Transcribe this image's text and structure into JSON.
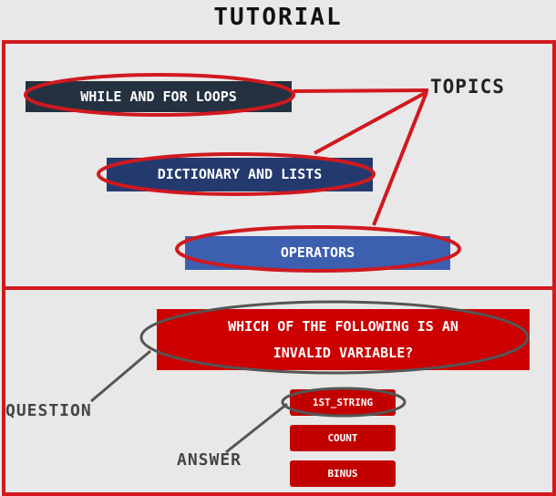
{
  "header": {
    "title": "TUTORIAL"
  },
  "topics": {
    "label": "TOPICS",
    "items": [
      {
        "label": "WHILE AND FOR LOOPS"
      },
      {
        "label": "DICTIONARY AND LISTS"
      },
      {
        "label": "OPERATORS"
      }
    ]
  },
  "question": {
    "label": "QUESTION",
    "line1": "WHICH OF THE FOLLOWING IS AN",
    "line2": "INVALID VARIABLE?"
  },
  "answers": {
    "label": "ANSWER",
    "options": [
      {
        "label": "1ST_STRING"
      },
      {
        "label": "COUNT"
      },
      {
        "label": "BINUS"
      }
    ]
  },
  "colors": {
    "accent_red": "#d0191f",
    "button_red": "#c20000",
    "topic_dark": "#243140",
    "topic_navy": "#243a6e",
    "topic_blue": "#3d5fb0",
    "annotation_gray": "#555555"
  }
}
